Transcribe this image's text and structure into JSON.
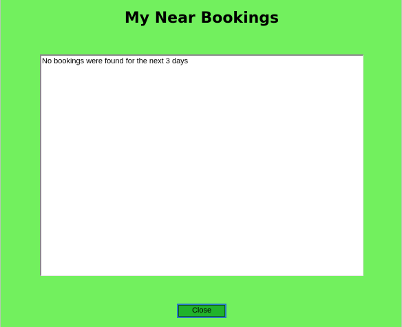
{
  "window": {
    "title": "My Near Bookings"
  },
  "bookings": {
    "lines": [
      "No bookings were found for the next  3 days"
    ]
  },
  "actions": {
    "close_label": "Close"
  },
  "colors": {
    "background": "#72f05e",
    "button": "#21b32b",
    "button_focus_border": "#2a78c8"
  }
}
